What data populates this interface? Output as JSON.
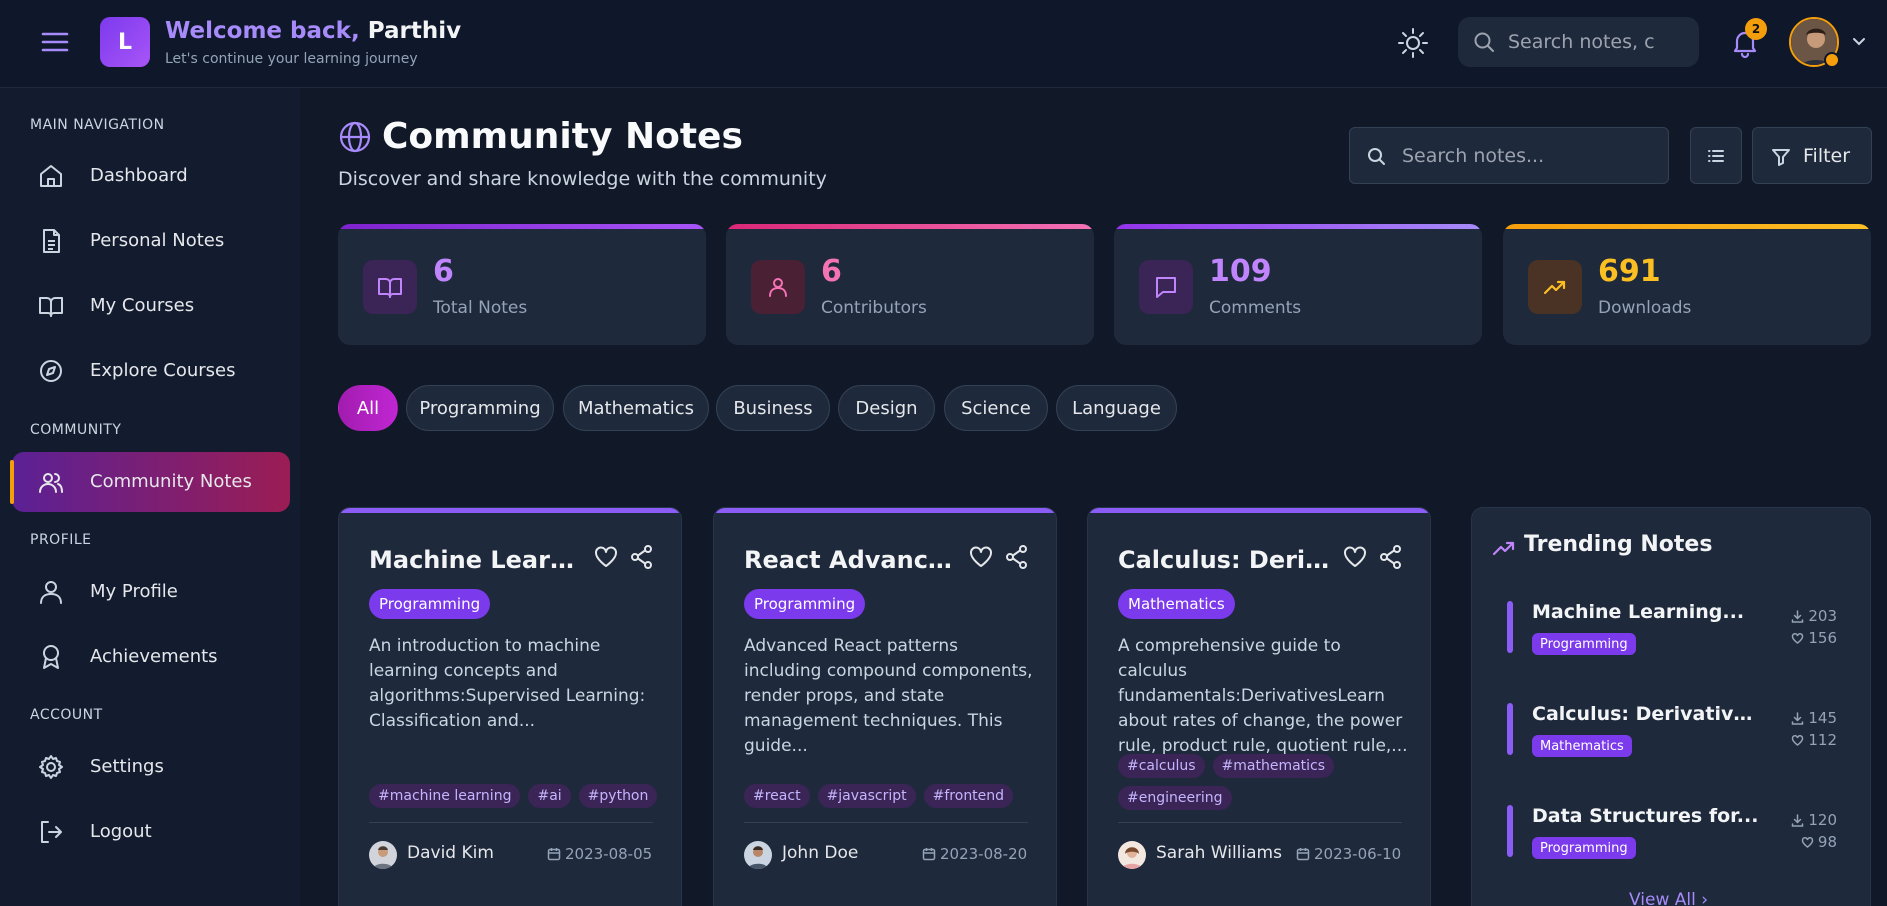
{
  "header": {
    "logo_letter": "L",
    "welcome_prefix": "Welcome back,",
    "welcome_name": "Parthiv",
    "subtitle": "Let's continue your learning journey",
    "search_placeholder": "Search notes, c",
    "notification_count": "2",
    "icons": [
      "menu-icon",
      "sun-icon",
      "search-icon",
      "bell-icon",
      "chevron-down-icon"
    ]
  },
  "sidebar": {
    "sections": [
      {
        "title": "MAIN NAVIGATION",
        "items": [
          {
            "label": "Dashboard",
            "icon": "home-icon"
          },
          {
            "label": "Personal Notes",
            "icon": "file-text-icon"
          },
          {
            "label": "My Courses",
            "icon": "book-open-icon"
          },
          {
            "label": "Explore Courses",
            "icon": "compass-icon"
          }
        ]
      },
      {
        "title": "COMMUNITY",
        "items": [
          {
            "label": "Community Notes",
            "icon": "users-icon",
            "active": true
          }
        ]
      },
      {
        "title": "PROFILE",
        "items": [
          {
            "label": "My Profile",
            "icon": "user-icon"
          },
          {
            "label": "Achievements",
            "icon": "award-icon"
          }
        ]
      },
      {
        "title": "ACCOUNT",
        "items": [
          {
            "label": "Settings",
            "icon": "gear-icon"
          },
          {
            "label": "Logout",
            "icon": "logout-icon"
          }
        ]
      }
    ]
  },
  "main": {
    "title": "Community Notes",
    "subtitle": "Discover and share knowledge with the community",
    "search_placeholder": "Search notes...",
    "filter_label": "Filter",
    "stats": [
      {
        "value": "6",
        "label": "Total Notes",
        "icon": "book-open-icon",
        "color": "#c084fc"
      },
      {
        "value": "6",
        "label": "Contributors",
        "icon": "user-icon",
        "color": "#f472b6"
      },
      {
        "value": "109",
        "label": "Comments",
        "icon": "message-icon",
        "color": "#c084fc"
      },
      {
        "value": "691",
        "label": "Downloads",
        "icon": "trending-up-icon",
        "color": "#fbbf24"
      }
    ],
    "categories": [
      "All",
      "Programming",
      "Mathematics",
      "Business",
      "Design",
      "Science",
      "Language"
    ],
    "active_category": "All",
    "notes": [
      {
        "title": "Machine Learnin...",
        "category": "Programming",
        "description": "An introduction to machine learning concepts and algorithms:Supervised Learning: Classification and...",
        "tags": [
          "#machine learning",
          "#ai",
          "#python"
        ],
        "author": "David Kim",
        "date": "2023-08-05"
      },
      {
        "title": "React Advanced ...",
        "category": "Programming",
        "description": "Advanced React patterns including compound components, render props, and state management techniques. This guide...",
        "tags": [
          "#react",
          "#javascript",
          "#frontend"
        ],
        "author": "John Doe",
        "date": "2023-08-20"
      },
      {
        "title": "Calculus: Derivat...",
        "category": "Mathematics",
        "description": "A comprehensive guide to calculus fundamentals:DerivativesLearn about rates of change, the power rule, product rule, quotient rule,...",
        "tags": [
          "#calculus",
          "#mathematics",
          "#engineering"
        ],
        "author": "Sarah Williams",
        "date": "2023-06-10"
      }
    ],
    "trending": {
      "title": "Trending Notes",
      "items": [
        {
          "title": "Machine Learning...",
          "category": "Programming",
          "downloads": "203",
          "likes": "156"
        },
        {
          "title": "Calculus: Derivatives &...",
          "category": "Mathematics",
          "downloads": "145",
          "likes": "112"
        },
        {
          "title": "Data Structures for...",
          "category": "Programming",
          "downloads": "120",
          "likes": "98"
        }
      ],
      "view_all": "View All"
    }
  }
}
